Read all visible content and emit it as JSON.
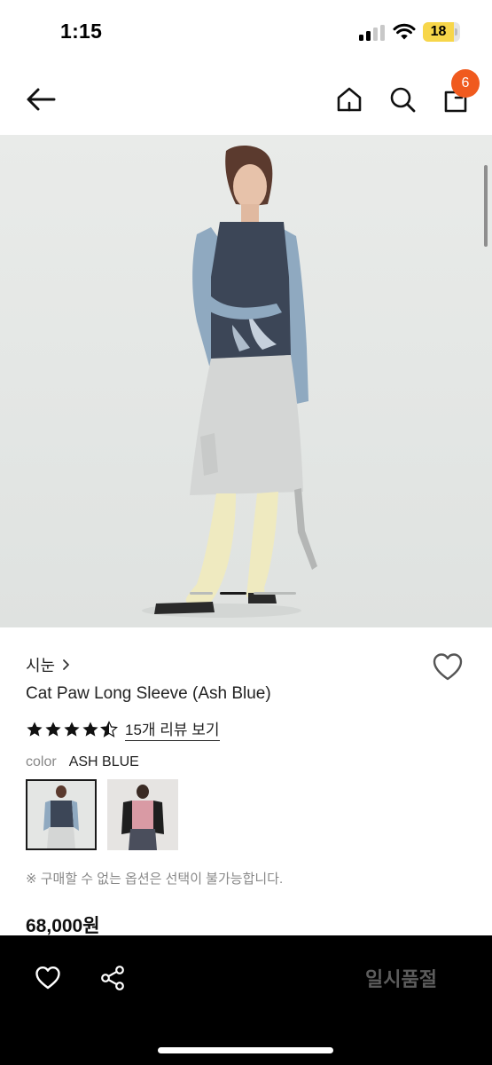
{
  "status_bar": {
    "time": "1:15",
    "battery_level": "18",
    "battery_color": "#f7d64a"
  },
  "header": {
    "icons": [
      "back-arrow-icon",
      "home-icon",
      "search-icon",
      "shopping-bag-icon"
    ],
    "cart_count": "6",
    "badge_color": "#f05a1e"
  },
  "gallery": {
    "page_count": 3,
    "active_index": 1
  },
  "product": {
    "brand": "시눈",
    "name": "Cat Paw Long Sleeve (Ash Blue)",
    "rating_stars": 4.5,
    "review_link": "15개 리뷰 보기",
    "color_label": "color",
    "color_value": "ASH BLUE",
    "notice": "※ 구매할 수 없는 옵션은 선택이 불가능합니다.",
    "price": "68,000원"
  },
  "bottom_bar": {
    "icons": [
      "heart-icon",
      "share-icon"
    ],
    "soldout_label": "일시품절"
  }
}
